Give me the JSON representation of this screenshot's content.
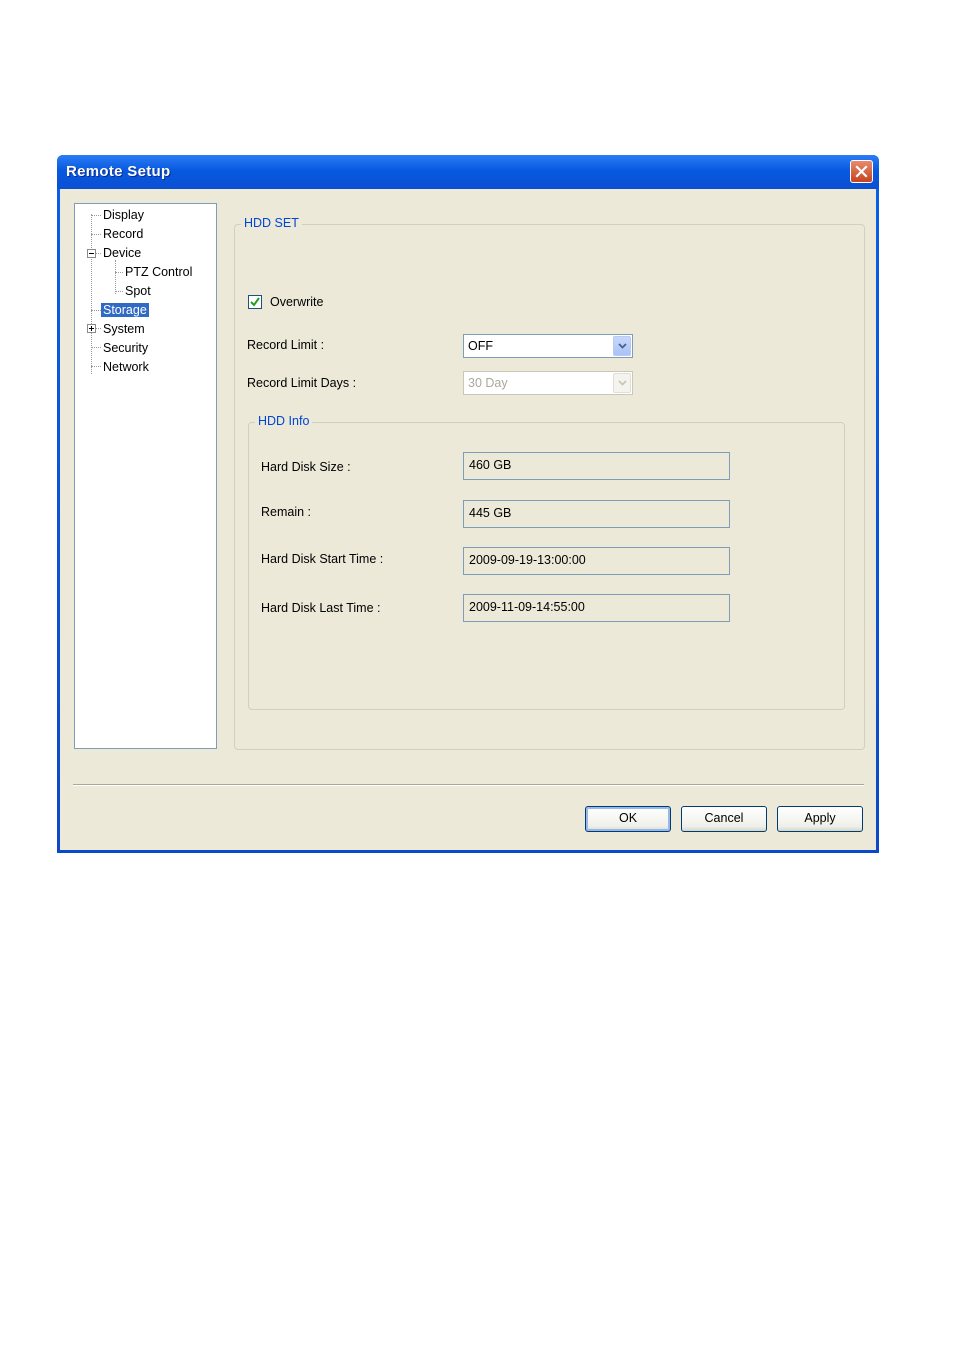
{
  "window": {
    "title": "Remote Setup"
  },
  "tree": {
    "items": [
      {
        "label": "Display"
      },
      {
        "label": "Record"
      },
      {
        "label": "Device"
      },
      {
        "label": "PTZ Control"
      },
      {
        "label": "Spot"
      },
      {
        "label": "Storage",
        "selected": true
      },
      {
        "label": "System"
      },
      {
        "label": "Security"
      },
      {
        "label": "Network"
      }
    ]
  },
  "hdd_set": {
    "legend": "HDD SET",
    "overwrite": {
      "label": "Overwrite",
      "checked": true
    },
    "record_limit": {
      "label": "Record Limit :",
      "value": "OFF"
    },
    "record_limit_days": {
      "label": "Record Limit Days :",
      "value": "30 Day",
      "disabled": true
    }
  },
  "hdd_info": {
    "legend": "HDD Info",
    "fields": [
      {
        "label": "Hard Disk Size :",
        "value": "460 GB"
      },
      {
        "label": "Remain :",
        "value": "445 GB"
      },
      {
        "label": "Hard Disk Start Time :",
        "value": "2009-09-19-13:00:00"
      },
      {
        "label": "Hard Disk Last Time :",
        "value": "2009-11-09-14:55:00"
      }
    ]
  },
  "buttons": {
    "ok": "OK",
    "cancel": "Cancel",
    "apply": "Apply"
  },
  "colors": {
    "titlebar": "#0a4fd2",
    "face": "#ece9d8",
    "legend_text": "#0046d5",
    "selection": "#316ac5"
  }
}
